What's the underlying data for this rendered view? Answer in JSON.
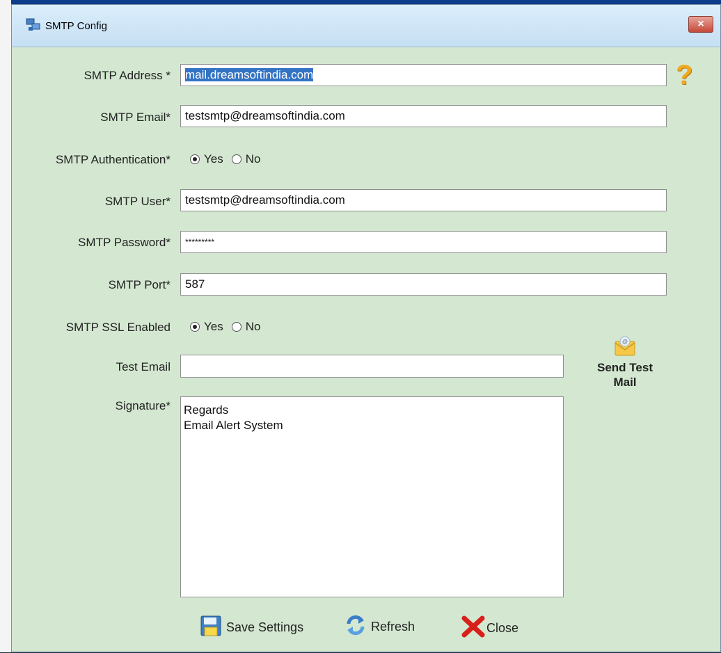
{
  "window": {
    "title": "SMTP Config",
    "close_glyph": "×"
  },
  "form": {
    "smtp_address": {
      "label": "SMTP Address *",
      "value": "mail.dreamsoftindia.com"
    },
    "smtp_email": {
      "label": "SMTP Email*",
      "value": "testsmtp@dreamsoftindia.com"
    },
    "smtp_auth": {
      "label": "SMTP Authentication*",
      "yes": "Yes",
      "no": "No",
      "selected": "Yes"
    },
    "smtp_user": {
      "label": "SMTP User*",
      "value": "testsmtp@dreamsoftindia.com"
    },
    "smtp_password": {
      "label": "SMTP Password*",
      "value": "*********"
    },
    "smtp_port": {
      "label": "SMTP Port*",
      "value": "587"
    },
    "smtp_ssl": {
      "label": "SMTP SSL Enabled",
      "yes": "Yes",
      "no": "No",
      "selected": "Yes"
    },
    "test_email": {
      "label": "Test Email",
      "value": ""
    },
    "signature": {
      "label": "Signature*",
      "line1": "Regards",
      "line2": "Email Alert System"
    }
  },
  "help_glyph": "?",
  "send_test": {
    "line1": "Send Test",
    "line2": "Mail"
  },
  "buttons": {
    "save": "Save Settings",
    "refresh": "Refresh",
    "close": "Close"
  },
  "icons": {
    "window": "network-icon",
    "help": "question-mark-icon",
    "send_test": "envelope-icon",
    "save": "save-disk-icon",
    "refresh": "refresh-icon",
    "close": "red-x-icon"
  },
  "colors": {
    "window_bg": "#d4e8d1",
    "selection": "#3373c4",
    "help": "#f0a820"
  }
}
